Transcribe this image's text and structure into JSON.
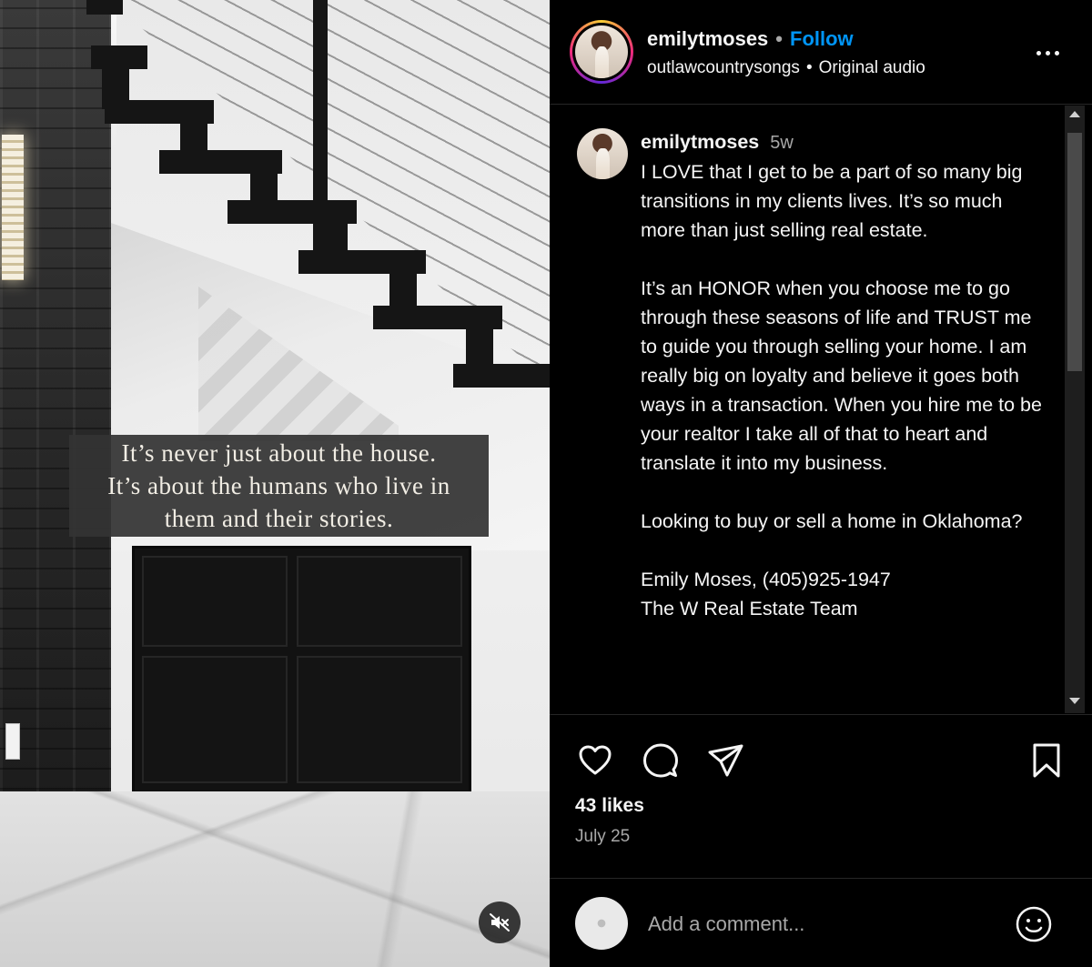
{
  "media": {
    "overlay_lines": [
      "It’s never just about the house.",
      "It’s about the humans who live in",
      "them and their stories."
    ],
    "mute_icon": "speaker-muted-icon"
  },
  "header": {
    "username": "emilytmoses",
    "separator": "•",
    "follow_label": "Follow",
    "audio_artist": "outlawcountrysongs",
    "audio_separator": "•",
    "audio_label": "Original audio",
    "more_icon": "more-options-icon"
  },
  "caption": {
    "username": "emilytmoses",
    "time": "5w",
    "paragraphs": [
      "I LOVE that I get to be a part of so many big transitions in my clients lives. It’s so much more than just selling real estate.",
      "It’s an HONOR when you choose me to go through these seasons of life and TRUST me to guide you through selling your home. I am really big on loyalty and believe it goes both ways in a transaction. When you hire me to be your realtor I take all of that to heart and translate it into my business.",
      "Looking to buy or sell a home in Oklahoma?"
    ],
    "contact_lines": [
      "Emily Moses, (405)925-1947",
      "The W Real Estate Team"
    ]
  },
  "actions": {
    "icons": [
      "heart-icon",
      "comment-icon",
      "share-icon",
      "bookmark-icon"
    ],
    "likes": "43 likes",
    "date": "July 25"
  },
  "comment": {
    "placeholder": "Add a comment...",
    "emoji_icon": "emoji-icon"
  },
  "colors": {
    "background": "#000000",
    "follow": "#0095f6",
    "text": "#f5f5f5",
    "muted": "#a8a8a8"
  }
}
